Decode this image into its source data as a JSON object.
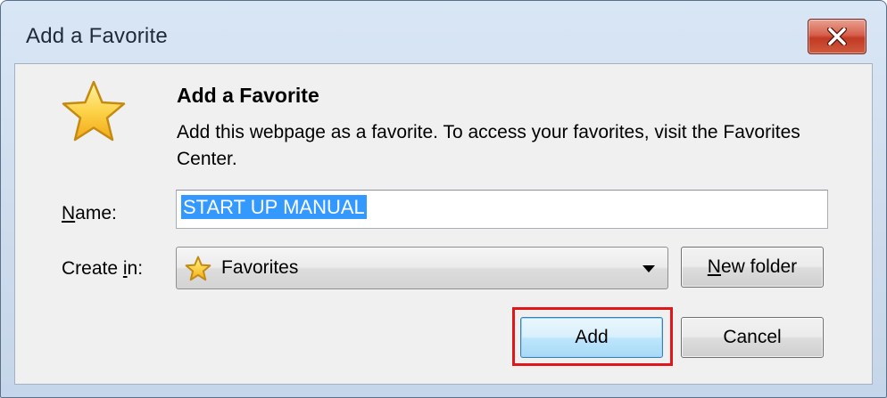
{
  "window": {
    "title": "Add a Favorite"
  },
  "dialog": {
    "heading": "Add a Favorite",
    "description": "Add this webpage as a favorite. To access your favorites, visit the Favorites Center.",
    "star_icon": "star-icon"
  },
  "name": {
    "label_accel": "N",
    "label_rest": "ame:",
    "value": "START UP MANUAL"
  },
  "create_in": {
    "label_pre": "Create ",
    "label_accel": "i",
    "label_post": "n:",
    "selected": "Favorites",
    "icon": "star-icon"
  },
  "buttons": {
    "new_folder_accel": "N",
    "new_folder_rest": "ew folder",
    "add": "Add",
    "cancel": "Cancel"
  },
  "colors": {
    "highlight": "#e0161b",
    "selection": "#3399ff",
    "close_button": "#c33a23"
  }
}
